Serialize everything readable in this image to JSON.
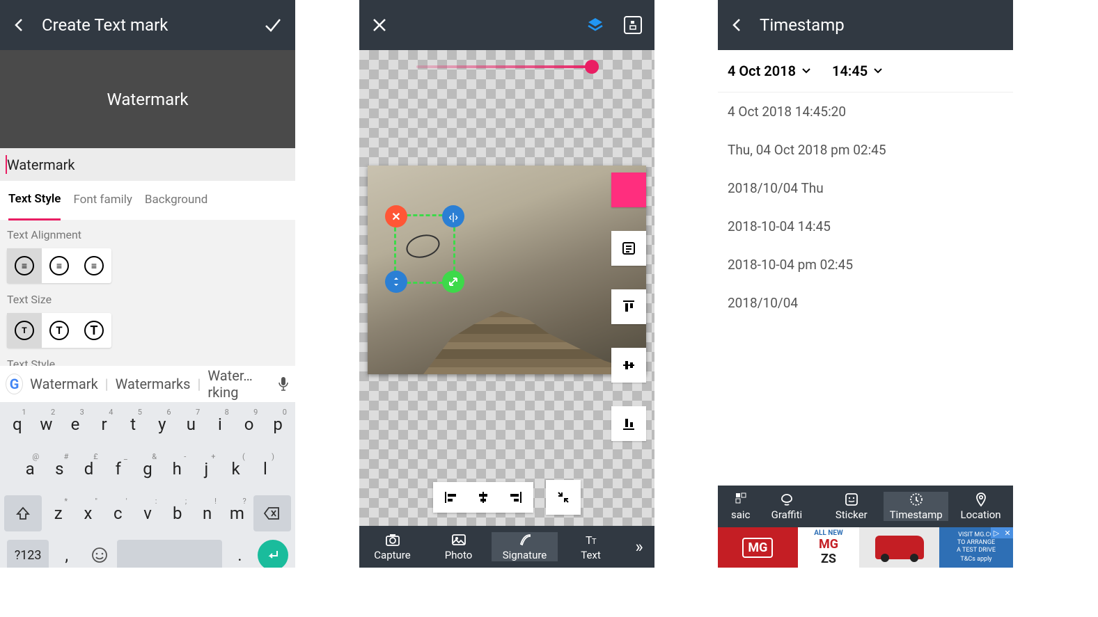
{
  "screen1": {
    "header": {
      "title": "Create Text mark"
    },
    "preview_text": "Watermark",
    "input_value": "Watermark",
    "tabs": {
      "style": "Text Style",
      "font": "Font family",
      "bg": "Background"
    },
    "options": {
      "alignment_label": "Text Alignment",
      "size_label": "Text Size",
      "style_label": "Text Style"
    },
    "suggestions": {
      "s1": "Watermark",
      "s2": "Watermarks",
      "s3": "Water…rking"
    },
    "keyboard": {
      "row1": [
        {
          "k": "q",
          "s": "1"
        },
        {
          "k": "w",
          "s": "2"
        },
        {
          "k": "e",
          "s": "3"
        },
        {
          "k": "r",
          "s": "4"
        },
        {
          "k": "t",
          "s": "5"
        },
        {
          "k": "y",
          "s": "6"
        },
        {
          "k": "u",
          "s": "7"
        },
        {
          "k": "i",
          "s": "8"
        },
        {
          "k": "o",
          "s": "9"
        },
        {
          "k": "p",
          "s": "0"
        }
      ],
      "row2": [
        {
          "k": "a",
          "s": "@"
        },
        {
          "k": "s",
          "s": "#"
        },
        {
          "k": "d",
          "s": "£"
        },
        {
          "k": "f",
          "s": "_"
        },
        {
          "k": "g",
          "s": "&"
        },
        {
          "k": "h",
          "s": "-"
        },
        {
          "k": "j",
          "s": "+"
        },
        {
          "k": "k",
          "s": "("
        },
        {
          "k": "l",
          "s": ")"
        }
      ],
      "row3": [
        {
          "k": "z",
          "s": "*"
        },
        {
          "k": "x",
          "s": "\""
        },
        {
          "k": "c",
          "s": "'"
        },
        {
          "k": "v",
          "s": ":"
        },
        {
          "k": "b",
          "s": ";"
        },
        {
          "k": "n",
          "s": "!"
        },
        {
          "k": "m",
          "s": "?"
        }
      ],
      "sym": "?123",
      "comma": ",",
      "period": "."
    }
  },
  "screen2": {
    "toolbar": {
      "capture": "Capture",
      "photo": "Photo",
      "signature": "Signature",
      "text": "Text"
    }
  },
  "screen3": {
    "header": {
      "title": "Timestamp"
    },
    "selected": {
      "date": "4 Oct 2018",
      "time": "14:45"
    },
    "formats": [
      "4 Oct 2018 14:45:20",
      "Thu, 04 Oct 2018 pm 02:45",
      "2018/10/04 Thu",
      "2018-10-04 14:45",
      "2018-10-04 pm 02:45",
      "2018/10/04"
    ],
    "toolbar": {
      "mosaic": "saic",
      "graffiti": "Graffiti",
      "sticker": "Sticker",
      "timestamp": "Timestamp",
      "location": "Location"
    }
  },
  "ad": {
    "brand": "MG",
    "line1": "ALL NEW",
    "line2": "MG",
    "line3": "ZS",
    "cta1": "VISIT MG.CO",
    "cta2": "TO ARRANGE",
    "cta3": "A TEST DRIVE",
    "cta4": "T&Cs apply"
  }
}
